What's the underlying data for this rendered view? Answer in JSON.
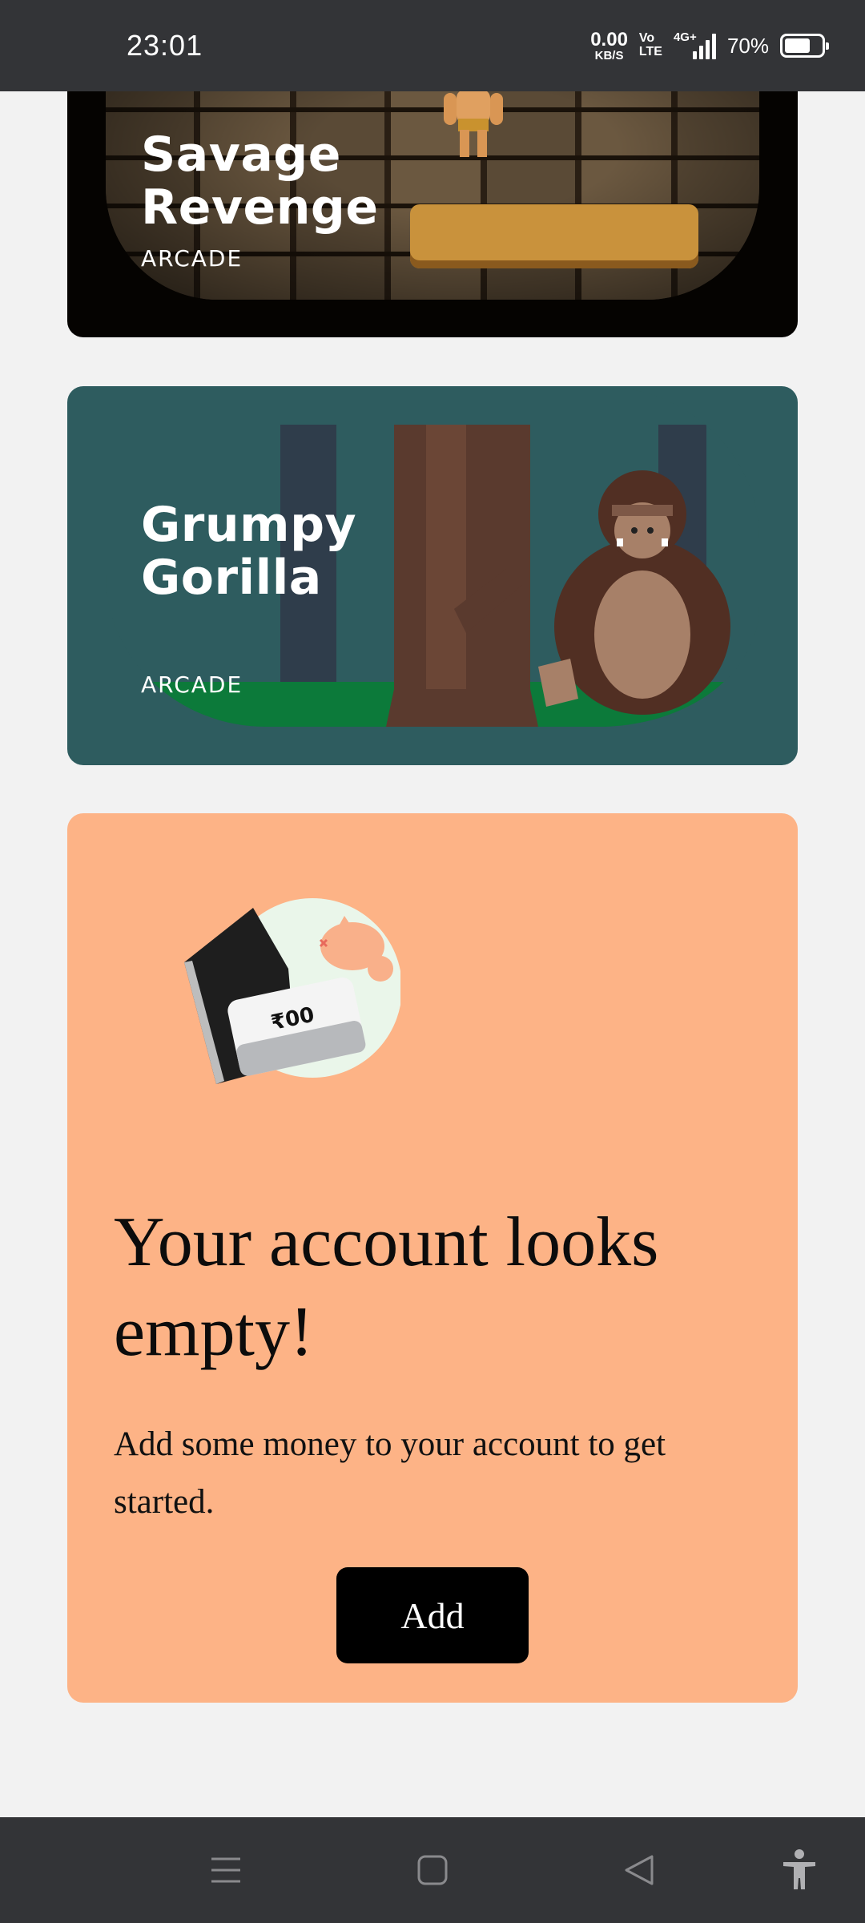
{
  "status_bar": {
    "time": "23:01",
    "net_speed_value": "0.00",
    "net_speed_unit": "KB/S",
    "volte_top": "Vo",
    "volte_bottom": "LTE",
    "network": "4G+",
    "battery_percent": "70%",
    "battery_level": 0.7
  },
  "games": [
    {
      "title_line1": "Savage",
      "title_line2": "Revenge",
      "genre": "ARCADE"
    },
    {
      "title_line1": "Grumpy",
      "title_line2": "Gorilla",
      "genre": "ARCADE"
    }
  ],
  "empty_account": {
    "amount_label": "₹00",
    "heading": "Your account looks empty!",
    "description": "Add some money to your account to get started.",
    "button_label": "Add",
    "background_color": "#fdb386"
  },
  "nav": {
    "menu_icon": "menu-icon",
    "home_icon": "home-square-icon",
    "back_icon": "back-triangle-icon",
    "accessibility_icon": "accessibility-icon"
  }
}
